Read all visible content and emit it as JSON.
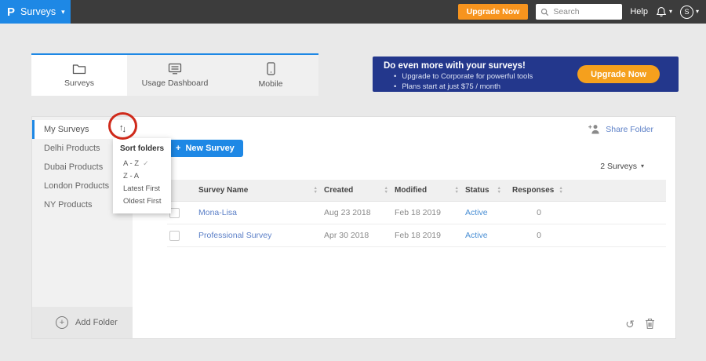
{
  "topbar": {
    "logo": "P",
    "product_menu": "Surveys",
    "upgrade_label": "Upgrade Now",
    "search_placeholder": "Search",
    "help_label": "Help",
    "avatar_initial": "S"
  },
  "tabs": [
    {
      "label": "Surveys",
      "active": true
    },
    {
      "label": "Usage Dashboard",
      "active": false
    },
    {
      "label": "Mobile",
      "active": false
    }
  ],
  "banner": {
    "title": "Do even more with your surveys!",
    "bullets": [
      "Upgrade to Corporate for powerful tools",
      "Plans start at just $75 / month"
    ],
    "cta": "Upgrade Now"
  },
  "sidebar": {
    "folders": [
      {
        "label": "My Surveys",
        "active": true
      },
      {
        "label": "Delhi Products",
        "active": false
      },
      {
        "label": "Dubai Products",
        "active": false
      },
      {
        "label": "London Products",
        "active": false
      },
      {
        "label": "NY Products",
        "active": false
      }
    ],
    "add_folder": "Add Folder"
  },
  "sort_menu": {
    "title": "Sort folders",
    "options": [
      {
        "label": "A - Z",
        "selected": true
      },
      {
        "label": "Z - A",
        "selected": false
      },
      {
        "label": "Latest First",
        "selected": false
      },
      {
        "label": "Oldest First",
        "selected": false
      }
    ]
  },
  "toolbar": {
    "new_survey_plus": "+",
    "new_survey": "New Survey",
    "share_folder": "Share Folder",
    "count": "2 Surveys"
  },
  "table": {
    "columns": [
      "Survey Name",
      "Created",
      "Modified",
      "Status",
      "Responses"
    ],
    "rows": [
      {
        "name": "Mona-Lisa",
        "created": "Aug 23 2018",
        "modified": "Feb 18 2019",
        "status": "Active",
        "responses": "0"
      },
      {
        "name": "Professional Survey",
        "created": "Apr 30 2018",
        "modified": "Feb 18 2019",
        "status": "Active",
        "responses": "0"
      }
    ]
  },
  "icons": {
    "caret_down": "▾",
    "check": "✓",
    "sort_up": "↑",
    "sort_down": "↓",
    "col_sort_up": "▲",
    "col_sort_down": "▼",
    "restore": "↺",
    "plus": "+",
    "bullet": "•"
  },
  "colors": {
    "accent_blue": "#1e88e5",
    "topbar_dark": "#3c3c3c",
    "orange": "#f7941e",
    "banner_navy": "#23378c",
    "link_blue": "#5b7fc7",
    "status_blue": "#4a8fd4",
    "annotation_red": "#cf2a1b"
  }
}
